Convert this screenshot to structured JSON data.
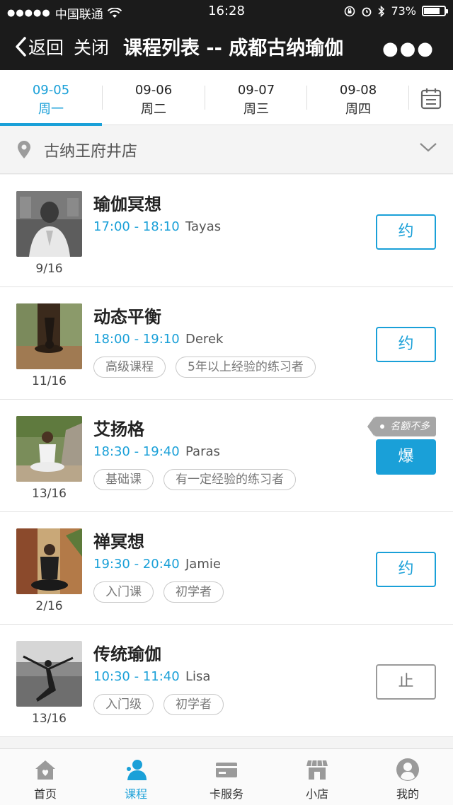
{
  "status": {
    "carrier": "中国联通",
    "time": "16:28",
    "battery": "73%"
  },
  "nav": {
    "back_label": "返回",
    "close_label": "关闭",
    "title": "课程列表 -- 成都古纳瑜伽"
  },
  "dates": [
    {
      "date": "09-05",
      "weekday": "周一",
      "active": true
    },
    {
      "date": "09-06",
      "weekday": "周二",
      "active": false
    },
    {
      "date": "09-07",
      "weekday": "周三",
      "active": false
    },
    {
      "date": "09-08",
      "weekday": "周四",
      "active": false
    }
  ],
  "store": {
    "name": "古纳王府井店"
  },
  "courses": [
    {
      "name": "瑜伽冥想",
      "time": "17:00 - 18:10",
      "coach": "Tayas",
      "count": "9/16",
      "tags": [],
      "button": "约"
    },
    {
      "name": "动态平衡",
      "time": "18:00 - 19:10",
      "coach": "Derek",
      "count": "11/16",
      "tags": [
        "高级课程",
        "5年以上经验的练习者"
      ],
      "button": "约"
    },
    {
      "name": "艾扬格",
      "time": "18:30 - 19:40",
      "coach": "Paras",
      "count": "13/16",
      "tags": [
        "基础课",
        "有一定经验的练习者"
      ],
      "button": "爆",
      "hint": "名额不多"
    },
    {
      "name": "禅冥想",
      "time": "19:30 - 20:40",
      "coach": "Jamie",
      "count": "2/16",
      "tags": [
        "入门课",
        "初学者"
      ],
      "button": "约"
    },
    {
      "name": "传统瑜伽",
      "time": "10:30 - 11:40",
      "coach": "Lisa",
      "count": "13/16",
      "tags": [
        "入门级",
        "初学者"
      ],
      "button": "止"
    }
  ],
  "tabs": [
    {
      "label": "首页",
      "icon": "home-icon"
    },
    {
      "label": "课程",
      "icon": "person-icon",
      "active": true
    },
    {
      "label": "卡服务",
      "icon": "card-icon"
    },
    {
      "label": "小店",
      "icon": "store-icon"
    },
    {
      "label": "我的",
      "icon": "profile-icon"
    }
  ],
  "colors": {
    "accent": "#1aa0d8",
    "topbar": "#1b1b1b"
  }
}
